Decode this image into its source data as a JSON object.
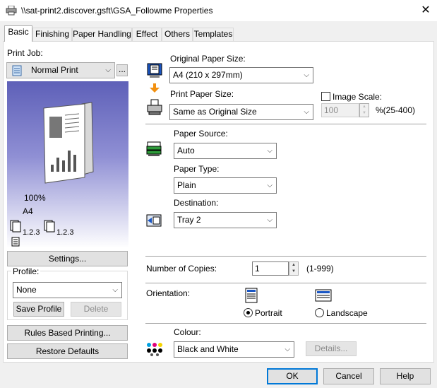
{
  "window": {
    "title": "\\\\sat-print2.discover.gsft\\GSA_Followme Properties",
    "close_glyph": "✕"
  },
  "tabs": [
    {
      "label": "Basic",
      "active": true
    },
    {
      "label": "Finishing"
    },
    {
      "label": "Paper Handling"
    },
    {
      "label": "Effect"
    },
    {
      "label": "Others"
    },
    {
      "label": "Templates"
    }
  ],
  "left": {
    "print_job_label": "Print Job:",
    "print_job_value": "Normal Print",
    "print_job_more": "...",
    "preview": {
      "zoom": "100%",
      "paper": "A4",
      "copies_label_1": "1.2.3",
      "copies_label_2": "1.2.3"
    },
    "settings_button": "Settings...",
    "profile_label": "Profile:",
    "profile_value": "None",
    "save_profile_button": "Save Profile",
    "delete_button": "Delete",
    "rules_button": "Rules Based Printing...",
    "restore_button": "Restore Defaults"
  },
  "right": {
    "original_paper_size_label": "Original Paper Size:",
    "original_paper_size_value": "A4 (210 x 297mm)",
    "print_paper_size_label": "Print Paper Size:",
    "print_paper_size_value": "Same as Original Size",
    "image_scale_label": "Image Scale:",
    "image_scale_value": "100",
    "image_scale_range": "%(25-400)",
    "paper_source_label": "Paper Source:",
    "paper_source_value": "Auto",
    "paper_type_label": "Paper Type:",
    "paper_type_value": "Plain",
    "destination_label": "Destination:",
    "destination_value": "Tray 2",
    "copies_label": "Number of Copies:",
    "copies_value": "1",
    "copies_range": "(1-999)",
    "orientation_label": "Orientation:",
    "portrait_label": "Portrait",
    "landscape_label": "Landscape",
    "orientation_selected": "Portrait",
    "colour_label": "Colour:",
    "colour_value": "Black and White",
    "details_button": "Details..."
  },
  "footer": {
    "ok_button": "OK",
    "cancel_button": "Cancel",
    "help_button": "Help"
  },
  "colors": {
    "accent": "#0078d7",
    "preview_top": "#5e60b8",
    "orange_arrow": "#f29111"
  }
}
